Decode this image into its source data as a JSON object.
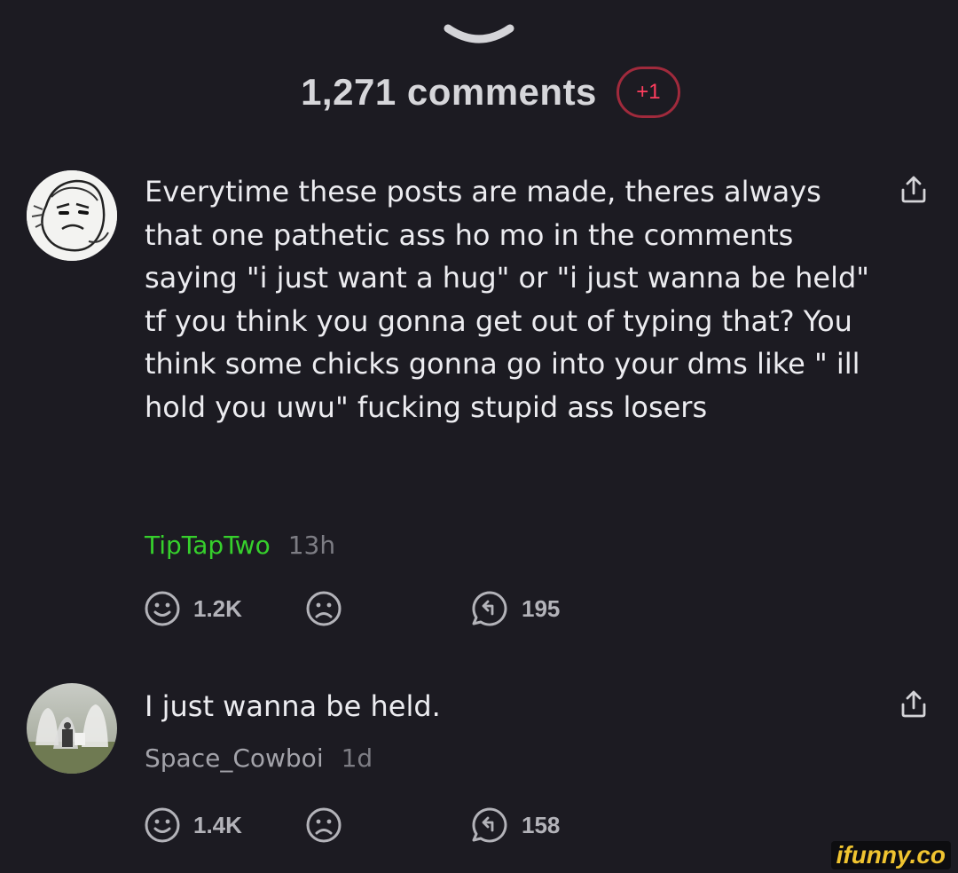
{
  "header": {
    "title": "1,271 comments",
    "new_badge": "+1"
  },
  "comments": [
    {
      "text": "Everytime these posts are made, theres always that one pathetic ass ho mo in the comments saying \"i just want a hug\" or \"i just wanna be held\" tf you think you gonna get out of typing that? You think some chicks gonna go into your dms like \" ill hold you uwu\" fucking stupid ass losers",
      "username": "TipTapTwo",
      "time": "13h",
      "smile_count": "1.2K",
      "reply_count": "195",
      "avatar_icon": "sketch-face-avatar"
    },
    {
      "text": "I just wanna be held.",
      "username": "Space_Cowboi",
      "time": "1d",
      "smile_count": "1.4K",
      "reply_count": "158",
      "avatar_icon": "photo-avatar"
    }
  ],
  "watermark": "ifunny.co",
  "colors": {
    "background": "#1c1b22",
    "username_highlight": "#36d02c",
    "badge_red": "#ff3d5e",
    "watermark": "#f0c430"
  }
}
